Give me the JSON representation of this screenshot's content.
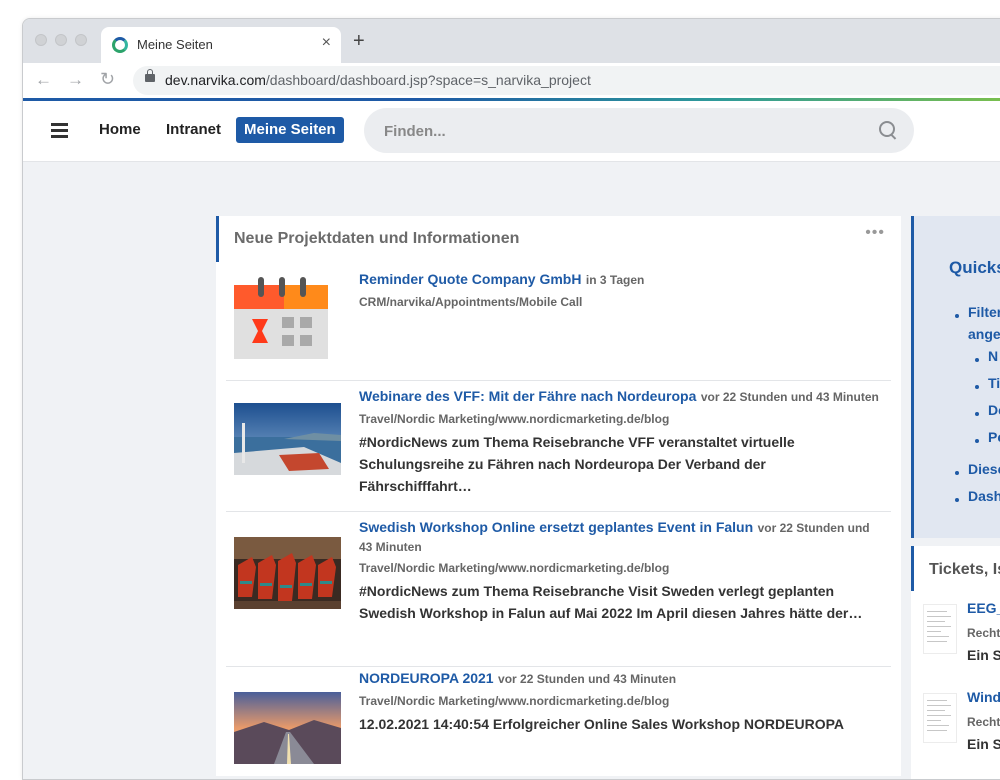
{
  "browser": {
    "tab_title": "Meine Seiten",
    "tab_close": "×",
    "new_tab": "+",
    "url_host": "dev.narvika.com",
    "url_path": "/dashboard/dashboard.jsp?space=s_narvika_project"
  },
  "header": {
    "nav": [
      "Home",
      "Intranet"
    ],
    "active": "Meine Seiten",
    "search_placeholder": "Finden..."
  },
  "main": {
    "title": "Neue Projektdaten und Informationen",
    "menu": "•••",
    "entries": [
      {
        "title": "Reminder Quote Company GmbH",
        "time": "in 3 Tagen",
        "path": "CRM/narvika/Appointments/Mobile Call",
        "desc1": "",
        "desc2": ""
      },
      {
        "title": "Webinare des VFF: Mit der Fähre nach Nordeuropa",
        "time": "vor 22 Stunden und 43 Minuten",
        "path": "Travel/Nordic Marketing/www.nordicmarketing.de/blog",
        "desc1": "#NordicNews zum Thema Reisebranche VFF veranstaltet virtuelle",
        "desc2": "Schulungsreihe zu Fähren nach Nordeuropa Der Verband der Fährschifffahrt…"
      },
      {
        "title": "Swedish Workshop Online ersetzt geplantes Event in Falun",
        "time": "vor 22 Stunden und 43 Minuten",
        "path": "Travel/Nordic Marketing/www.nordicmarketing.de/blog",
        "desc1": "#NordicNews zum Thema Reisebranche Visit Sweden verlegt geplanten",
        "desc2": "Swedish Workshop in Falun auf Mai 2022 Im April diesen Jahres hätte der…"
      },
      {
        "title": "NORDEUROPA 2021",
        "time": "vor 22 Stunden und 43 Minuten",
        "path": "Travel/Nordic Marketing/www.nordicmarketing.de/blog",
        "desc1": "12.02.2021 14:40:54 Erfolgreicher Online Sales Workshop NORDEUROPA",
        "desc2": ""
      }
    ]
  },
  "quickstart": {
    "title": "Quicks",
    "items": [
      "Filter",
      "ange",
      "N",
      "Ti",
      "De",
      "Pe",
      "Diese",
      "Dash"
    ]
  },
  "tickets": {
    "title": "Tickets, Is",
    "items": [
      {
        "name": "EEG_",
        "path": "Recht/",
        "desc": "Ein S"
      },
      {
        "name": "Wind",
        "path": "Recht/",
        "desc": "Ein S"
      }
    ]
  }
}
